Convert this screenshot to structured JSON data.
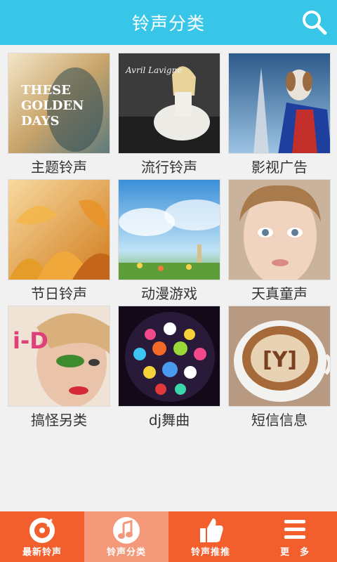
{
  "header": {
    "title": "铃声分类",
    "search_icon": "search-icon",
    "background_color": "#37c6e8"
  },
  "categories": [
    {
      "label": "主题铃声",
      "image": "these-golden-days-album-cover",
      "cover_text": [
        "THESE",
        "GOLDEN",
        "DAYS"
      ]
    },
    {
      "label": "流行铃声",
      "image": "avril-lavigne-album-cover",
      "cover_text": [
        "Avril Lavigne"
      ]
    },
    {
      "label": "影视广告",
      "image": "dog-eiffel-tower-poster"
    },
    {
      "label": "节日铃声",
      "image": "autumn-leaves-illustration"
    },
    {
      "label": "动漫游戏",
      "image": "anime-sky-illustration"
    },
    {
      "label": "天真童声",
      "image": "child-portrait-photo"
    },
    {
      "label": "搞怪另类",
      "image": "id-magazine-cover",
      "cover_text": [
        "i-D"
      ]
    },
    {
      "label": "dj舞曲",
      "image": "disco-ball-photo"
    },
    {
      "label": "短信信息",
      "image": "latte-art-cup",
      "cover_text": [
        "[Y]"
      ]
    }
  ],
  "bottom_nav": [
    {
      "label": "最新铃声",
      "icon": "vinyl-record-icon",
      "active": false
    },
    {
      "label": "铃声分类",
      "icon": "music-note-icon",
      "active": true
    },
    {
      "label": "铃声推推",
      "icon": "thumbs-up-icon",
      "active": false
    },
    {
      "label": "更　多",
      "icon": "menu-lines-icon",
      "active": false
    }
  ],
  "colors": {
    "nav_background": "#f25e2c",
    "nav_active": "#f4987a"
  }
}
